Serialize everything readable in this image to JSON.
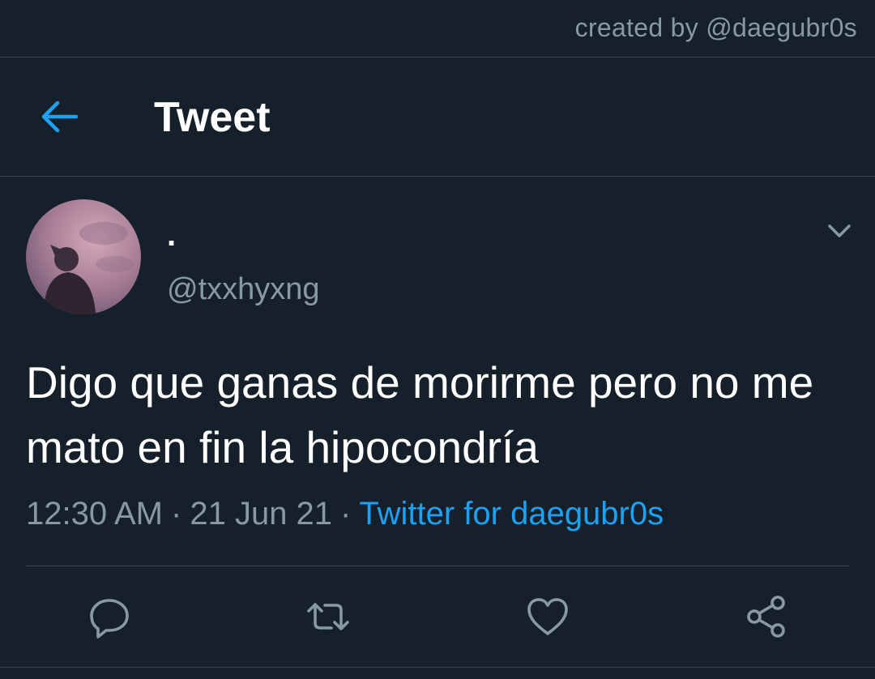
{
  "credit": "created by @daegubr0s",
  "header": {
    "title": "Tweet"
  },
  "tweet": {
    "author": {
      "display_name": ".",
      "handle": "@txxhyxng"
    },
    "text": "Digo que ganas de morirme pero no me mato en fin la hipocondría",
    "time": "12:30 AM",
    "date": "21 Jun 21",
    "separator": "·",
    "source": "Twitter for daegubr0s"
  },
  "actions": {
    "reply_icon": "reply-icon",
    "retweet_icon": "retweet-icon",
    "like_icon": "heart-icon",
    "share_icon": "share-icon"
  },
  "colors": {
    "background": "#15202b",
    "accent": "#1da1f2",
    "secondary_text": "#8899a6",
    "border": "#38444d"
  }
}
